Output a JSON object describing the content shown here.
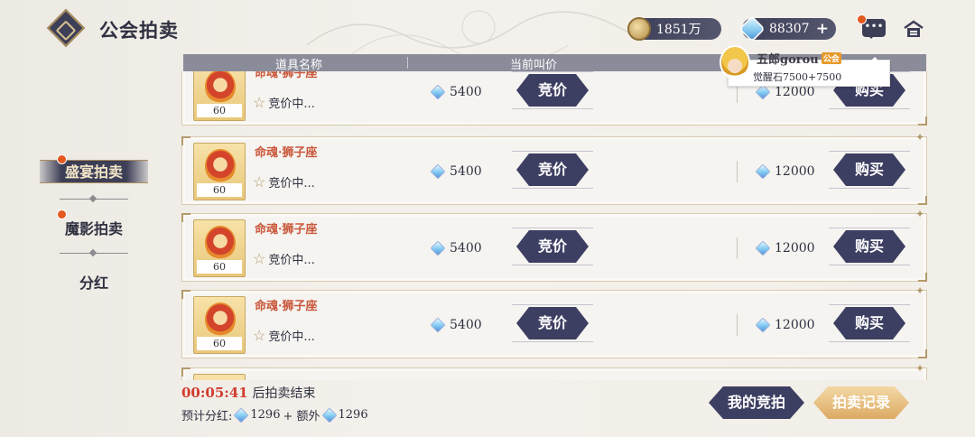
{
  "header": {
    "title": "公会拍卖",
    "gold_amount": "1851万",
    "gem_amount": "88307",
    "plus_symbol": "+"
  },
  "sidebar": {
    "tabs": [
      {
        "label": "盛宴拍卖",
        "active": true,
        "notify": true
      },
      {
        "label": "魔影拍卖",
        "active": false,
        "notify": true
      },
      {
        "label": "分红",
        "active": false,
        "notify": false
      }
    ]
  },
  "table": {
    "col_item": "道具名称",
    "col_current": "当前叫价",
    "rows": [
      {
        "name": "命魂·狮子座",
        "count": "60",
        "status": "竞价中...",
        "current_price": "5400",
        "bid_label": "竞价",
        "buyout_price": "12000",
        "buy_label": "购买"
      },
      {
        "name": "命魂·狮子座",
        "count": "60",
        "status": "竞价中...",
        "current_price": "5400",
        "bid_label": "竞价",
        "buyout_price": "12000",
        "buy_label": "购买"
      },
      {
        "name": "命魂·狮子座",
        "count": "60",
        "status": "竞价中...",
        "current_price": "5400",
        "bid_label": "竞价",
        "buyout_price": "12000",
        "buy_label": "购买"
      },
      {
        "name": "命魂·狮子座",
        "count": "60",
        "status": "竞价中...",
        "current_price": "5400",
        "bid_label": "竞价",
        "buyout_price": "12000",
        "buy_label": "购买"
      }
    ]
  },
  "tooltip": {
    "player_name": "五郎gorou",
    "badge": "公会",
    "detail": "觉醒石7500+7500"
  },
  "footer": {
    "countdown": "00:05:41",
    "countdown_suffix": "后拍卖结束",
    "dividend_label": "预计分红:",
    "dividend_value": "1296",
    "extra_label": "+ 额外",
    "extra_value": "1296",
    "my_bids_label": "我的竞拍",
    "record_label": "拍卖记录"
  }
}
